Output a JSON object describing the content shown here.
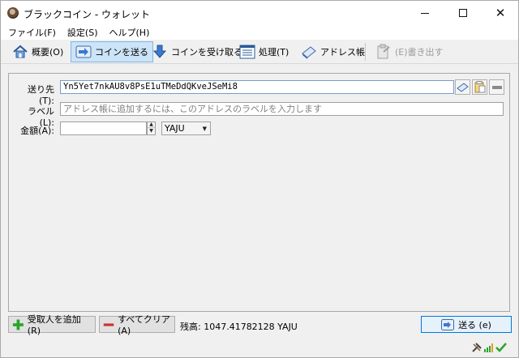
{
  "window": {
    "title": "ブラックコイン - ウォレット",
    "minimize_label": "",
    "close_label": "✕"
  },
  "menu": {
    "file": "ファイル(F)",
    "settings": "設定(S)",
    "help": "ヘルプ(H)"
  },
  "toolbar": {
    "overview": "概要(O)",
    "send": "コインを送る",
    "receive": "コインを受け取る",
    "transactions": "処理(T)",
    "address_book": "アドレス帳",
    "export": "(E)書き出す",
    "active_tab": "send"
  },
  "form": {
    "pay_to_label": "送り先(T):",
    "pay_to_value": "Yn5Yet7nkAU8v8PsE1uTMeDdQKveJSeMi8",
    "label_label": "ラベル(L):",
    "label_placeholder": "アドレス帳に追加するには、このアドレスのラベルを入力します",
    "amount_label": "金額(A):",
    "amount_value": "",
    "unit": "YAJU",
    "spin_up": "▲",
    "spin_down": "▼",
    "unit_arrow": "▼"
  },
  "actions": {
    "add_recipient": "受取人を追加 (R)",
    "clear_all": "すべてクリア (A)",
    "balance": "残高: 1047.41782128 YAJU",
    "send": "送る (e)"
  },
  "colors": {
    "accent": "#0078d7",
    "active_tab_bg": "#cce4f7",
    "status_ok": "#2aa52a"
  }
}
